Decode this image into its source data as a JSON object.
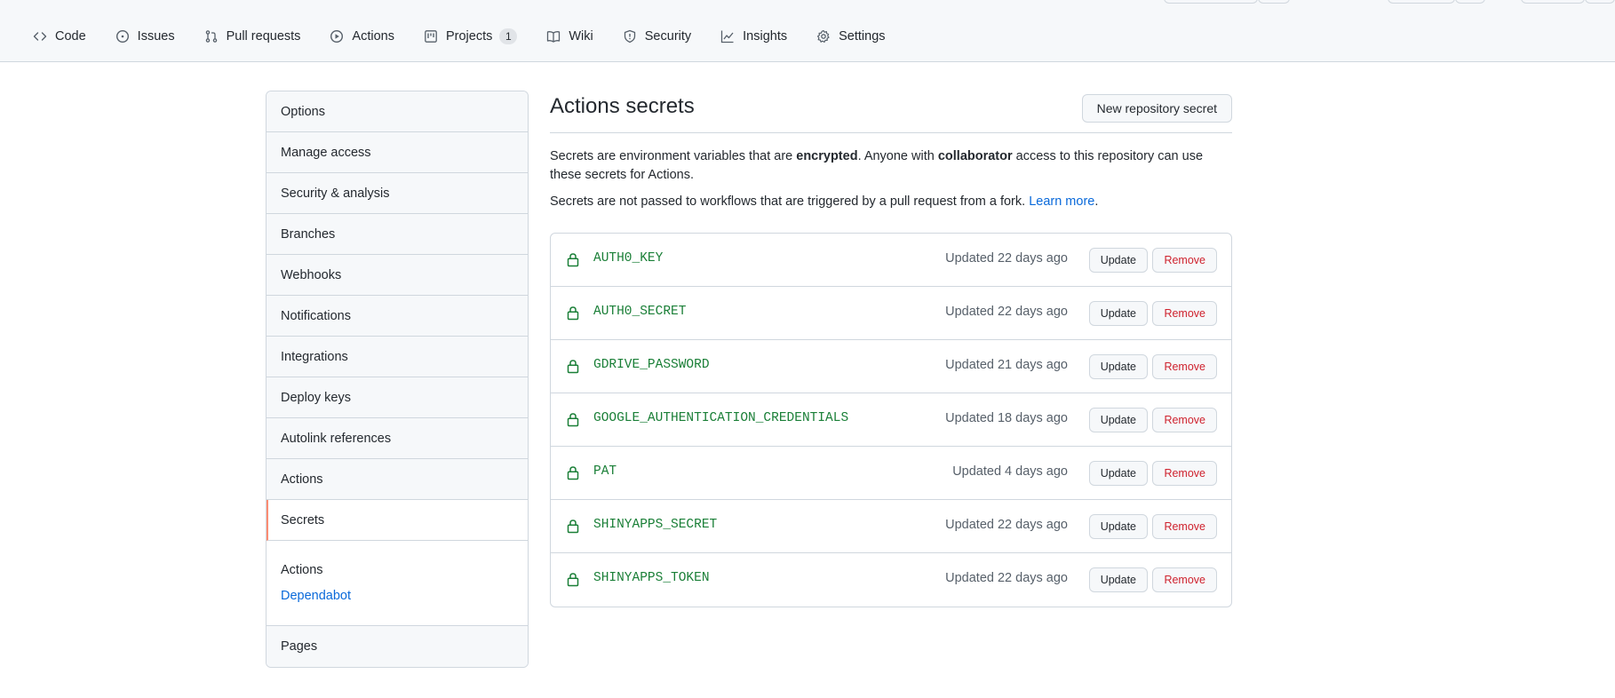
{
  "nav": {
    "tabs": [
      {
        "label": "Code",
        "icon": "code-icon"
      },
      {
        "label": "Issues",
        "icon": "issue-icon"
      },
      {
        "label": "Pull requests",
        "icon": "pull-request-icon"
      },
      {
        "label": "Actions",
        "icon": "play-icon"
      },
      {
        "label": "Projects",
        "icon": "project-icon",
        "count": "1"
      },
      {
        "label": "Wiki",
        "icon": "book-icon"
      },
      {
        "label": "Security",
        "icon": "shield-icon"
      },
      {
        "label": "Insights",
        "icon": "graph-icon"
      },
      {
        "label": "Settings",
        "icon": "gear-icon"
      }
    ]
  },
  "sidebar": {
    "items": [
      "Options",
      "Manage access",
      "Security & analysis",
      "Branches",
      "Webhooks",
      "Notifications",
      "Integrations",
      "Deploy keys",
      "Autolink references",
      "Actions",
      "Secrets"
    ],
    "selected": "Secrets",
    "subitems": [
      "Actions",
      "Dependabot"
    ],
    "last": "Pages"
  },
  "main": {
    "title": "Actions secrets",
    "new_button": "New repository secret",
    "desc1": {
      "a": "Secrets are environment variables that are ",
      "b": "encrypted",
      "c": ". Anyone with ",
      "d": "collaborator",
      "e": " access to this repository can use these secrets for Actions."
    },
    "desc2": {
      "a": "Secrets are not passed to workflows that are triggered by a pull request from a fork. ",
      "link": "Learn more",
      "b": "."
    },
    "update_label": "Update",
    "remove_label": "Remove",
    "secrets": [
      {
        "name": "AUTH0_KEY",
        "updated": "Updated 22 days ago"
      },
      {
        "name": "AUTH0_SECRET",
        "updated": "Updated 22 days ago"
      },
      {
        "name": "GDRIVE_PASSWORD",
        "updated": "Updated 21 days ago"
      },
      {
        "name": "GOOGLE_AUTHENTICATION_CREDENTIALS",
        "updated": "Updated 18 days ago"
      },
      {
        "name": "PAT",
        "updated": "Updated 4 days ago"
      },
      {
        "name": "SHINYAPPS_SECRET",
        "updated": "Updated 22 days ago"
      },
      {
        "name": "SHINYAPPS_TOKEN",
        "updated": "Updated 22 days ago"
      }
    ]
  },
  "colors": {
    "accent_selected": "#fd8c73",
    "secret_name": "#1a7f37",
    "link": "#0969da",
    "danger": "#cf222e"
  }
}
